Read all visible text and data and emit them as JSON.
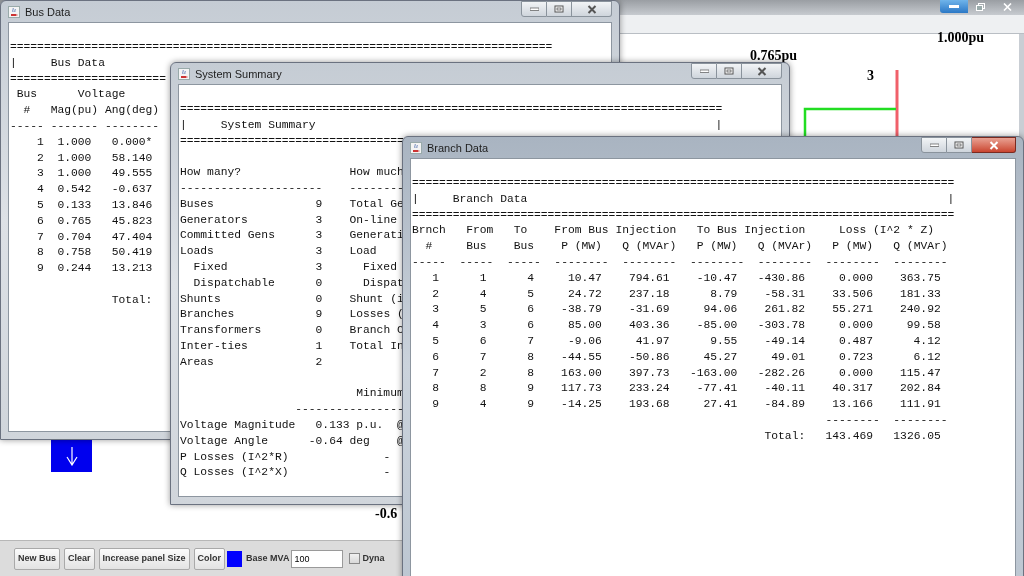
{
  "canvas": {
    "labels": [
      "0.765pu",
      "1.000pu",
      "3",
      "-0.6"
    ]
  },
  "toolbar": {
    "buttons": [
      "New Bus",
      "Clear",
      "Increase panel Size",
      "Color"
    ],
    "swatch": {
      "color": "#0000ff"
    },
    "base_mva": {
      "label": "Base MVA",
      "value": "100"
    },
    "checkbox": {
      "label": "Dyna",
      "checked": false
    }
  },
  "windows": [
    {
      "title": "Bus Data",
      "active": false,
      "content": [
        {
          "kind": "line",
          "text": "================================================================================"
        },
        {
          "kind": "banner",
          "left": "|     Bus Data"
        },
        {
          "kind": "line",
          "text": "======================="
        },
        {
          "kind": "line",
          "text": " Bus      Voltage"
        },
        {
          "kind": "line",
          "text": "  #   Mag(pu) Ang(deg)"
        },
        {
          "kind": "line",
          "text": "----- ------- --------"
        },
        {
          "kind": "row",
          "cells": [
            "1",
            "1.000",
            "0.000*"
          ]
        },
        {
          "kind": "row",
          "cells": [
            "2",
            "1.000",
            "58.140"
          ]
        },
        {
          "kind": "row",
          "cells": [
            "3",
            "1.000",
            "49.555"
          ]
        },
        {
          "kind": "row",
          "cells": [
            "4",
            "0.542",
            "-0.637"
          ]
        },
        {
          "kind": "row",
          "cells": [
            "5",
            "0.133",
            "13.846"
          ]
        },
        {
          "kind": "row",
          "cells": [
            "6",
            "0.765",
            "45.823"
          ]
        },
        {
          "kind": "row",
          "cells": [
            "7",
            "0.704",
            "47.404"
          ]
        },
        {
          "kind": "row",
          "cells": [
            "8",
            "0.758",
            "50.419"
          ]
        },
        {
          "kind": "row",
          "cells": [
            "9",
            "0.244",
            "13.213"
          ]
        },
        {
          "kind": "blank"
        },
        {
          "kind": "line",
          "text": "               Total:"
        }
      ]
    },
    {
      "title": "System Summary",
      "active": false,
      "content": [
        {
          "kind": "line",
          "text": "================================================================================"
        },
        {
          "kind": "banner",
          "left": "|     System Summary",
          "right": "|"
        },
        {
          "kind": "line",
          "text": "================================="
        },
        {
          "kind": "blank"
        },
        {
          "kind": "line",
          "text": "How many?                How much"
        },
        {
          "kind": "line",
          "text": "---------------------    --------"
        },
        {
          "kind": "line",
          "text": "Buses               9    Total Ge"
        },
        {
          "kind": "line",
          "text": "Generators          3    On-line"
        },
        {
          "kind": "line",
          "text": "Committed Gens      3    Generati"
        },
        {
          "kind": "line",
          "text": "Loads               3    Load"
        },
        {
          "kind": "line",
          "text": "  Fixed             3      Fixed"
        },
        {
          "kind": "line",
          "text": "  Dispatchable      0      Dispat"
        },
        {
          "kind": "line",
          "text": "Shunts              0    Shunt (i"
        },
        {
          "kind": "line",
          "text": "Branches            9    Losses ("
        },
        {
          "kind": "line",
          "text": "Transformers        0    Branch C"
        },
        {
          "kind": "line",
          "text": "Inter-ties          1    Total In"
        },
        {
          "kind": "line",
          "text": "Areas               2"
        },
        {
          "kind": "blank"
        },
        {
          "kind": "line",
          "text": "                          Minimum"
        },
        {
          "kind": "line",
          "text": "                 ----------------"
        },
        {
          "kind": "line",
          "text": "Voltage Magnitude   0.133 p.u.  @"
        },
        {
          "kind": "line",
          "text": "Voltage Angle      -0.64 deg    @"
        },
        {
          "kind": "line",
          "text": "P Losses (I^2*R)              -"
        },
        {
          "kind": "line",
          "text": "Q Losses (I^2*X)              -"
        }
      ]
    },
    {
      "title": "Branch Data",
      "active": true,
      "content": [
        {
          "kind": "line",
          "text": "================================================================================"
        },
        {
          "kind": "banner",
          "left": "|     Branch Data",
          "right": "|"
        },
        {
          "kind": "line",
          "text": "================================================================================"
        },
        {
          "kind": "line",
          "text": "Brnch   From   To    From Bus Injection   To Bus Injection     Loss (I^2 * Z)"
        },
        {
          "kind": "line",
          "text": "  #     Bus    Bus    P (MW)   Q (MVAr)   P (MW)   Q (MVAr)   P (MW)   Q (MVAr)"
        },
        {
          "kind": "line",
          "text": "-----  -----  -----  --------  --------  --------  --------  --------  --------"
        },
        {
          "kind": "row",
          "cells": [
            "1",
            "1",
            "4",
            "10.47",
            "794.61",
            "-10.47",
            "-430.86",
            "0.000",
            "363.75"
          ]
        },
        {
          "kind": "row",
          "cells": [
            "2",
            "4",
            "5",
            "24.72",
            "237.18",
            "8.79",
            "-58.31",
            "33.506",
            "181.33"
          ]
        },
        {
          "kind": "row",
          "cells": [
            "3",
            "5",
            "6",
            "-38.79",
            "-31.69",
            "94.06",
            "261.82",
            "55.271",
            "240.92"
          ]
        },
        {
          "kind": "row",
          "cells": [
            "4",
            "3",
            "6",
            "85.00",
            "403.36",
            "-85.00",
            "-303.78",
            "0.000",
            "99.58"
          ]
        },
        {
          "kind": "row",
          "cells": [
            "5",
            "6",
            "7",
            "-9.06",
            "41.97",
            "9.55",
            "-49.14",
            "0.487",
            "4.12"
          ]
        },
        {
          "kind": "row",
          "cells": [
            "6",
            "7",
            "8",
            "-44.55",
            "-50.86",
            "45.27",
            "49.01",
            "0.723",
            "6.12"
          ]
        },
        {
          "kind": "row",
          "cells": [
            "7",
            "2",
            "8",
            "163.00",
            "397.73",
            "-163.00",
            "-282.26",
            "0.000",
            "115.47"
          ]
        },
        {
          "kind": "row",
          "cells": [
            "8",
            "8",
            "9",
            "117.73",
            "233.24",
            "-77.41",
            "-40.11",
            "40.317",
            "202.84"
          ]
        },
        {
          "kind": "row",
          "cells": [
            "9",
            "4",
            "9",
            "-14.25",
            "193.68",
            "27.41",
            "-84.89",
            "13.166",
            "111.91"
          ]
        },
        {
          "kind": "line",
          "text": "                                                             --------  --------"
        },
        {
          "kind": "line",
          "text": "                                                    Total:   143.469   1326.05"
        }
      ]
    }
  ]
}
